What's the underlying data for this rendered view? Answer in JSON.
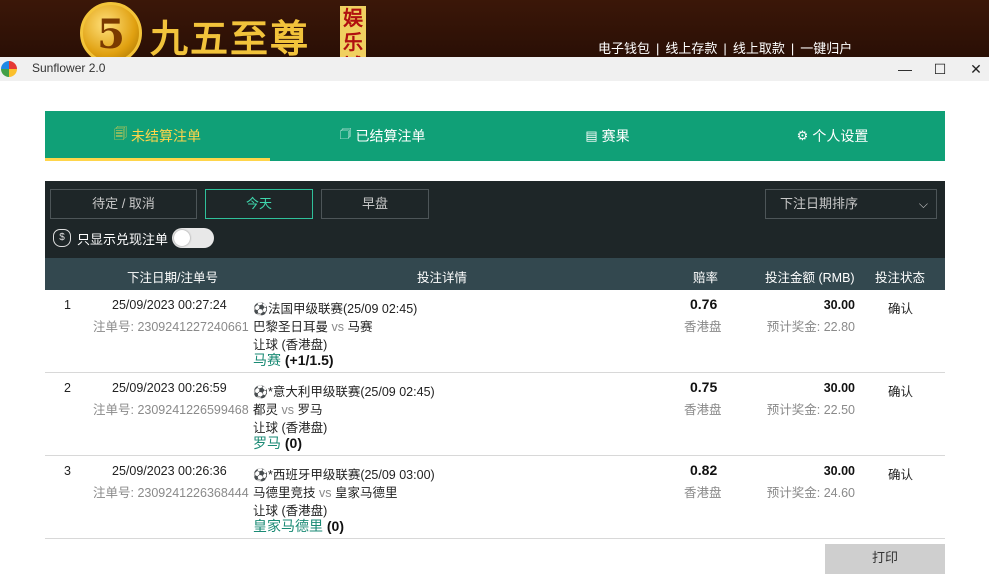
{
  "banner": {
    "logo_numeral": "5",
    "logo_text": "九五至尊",
    "logo_tag": "娱乐城",
    "links": [
      "电子钱包",
      "线上存款",
      "线上取款",
      "一键归户"
    ],
    "separator": "|"
  },
  "window": {
    "title": "Sunflower 2.0",
    "minimize": "—",
    "maximize": "☐",
    "close": "✕"
  },
  "tabs": [
    {
      "label": "未结算注单",
      "icon": "receipt-icon",
      "glyph": "🗐",
      "active": true
    },
    {
      "label": "已结算注单",
      "icon": "settled-icon",
      "glyph": "🗇",
      "active": false
    },
    {
      "label": "赛果",
      "icon": "results-icon",
      "glyph": "▤",
      "active": false
    },
    {
      "label": "个人设置",
      "icon": "gear-icon",
      "glyph": "⚙",
      "active": false
    }
  ],
  "filters": {
    "pending_cancel": "待定 / 取消",
    "today": "今天",
    "early": "早盘",
    "sort_selected": "下注日期排序",
    "cashout_toggle_label": "只显示兑现注单",
    "cashout_icon_glyph": "$",
    "chevron": "⌵"
  },
  "table": {
    "headers": {
      "date_id": "下注日期/注单号",
      "details": "投注详情",
      "odds": "赔率",
      "amount": "投注金额 (RMB)",
      "status": "投注状态"
    },
    "rows": [
      {
        "index": "1",
        "datetime": "25/09/2023 00:27:24",
        "bet_id_label": "注单号: 2309241227240661",
        "league": "法国甲级联赛(25/09 02:45)",
        "home": "巴黎圣日耳曼",
        "vs": "vs",
        "away": "马赛",
        "market": "让球 (香港盘)",
        "pick_team": "马赛",
        "pick_line": "(+1/1.5)",
        "odds": "0.76",
        "odds_type": "香港盘",
        "stake": "30.00",
        "payout": "预计奖金: 22.80",
        "status": "确认"
      },
      {
        "index": "2",
        "datetime": "25/09/2023 00:26:59",
        "bet_id_label": "注单号: 2309241226599468",
        "league": "*意大利甲级联赛(25/09 02:45)",
        "home": "都灵",
        "vs": "vs",
        "away": "罗马",
        "market": "让球 (香港盘)",
        "pick_team": "罗马",
        "pick_line": "(0)",
        "odds": "0.75",
        "odds_type": "香港盘",
        "stake": "30.00",
        "payout": "预计奖金: 22.50",
        "status": "确认"
      },
      {
        "index": "3",
        "datetime": "25/09/2023 00:26:36",
        "bet_id_label": "注单号: 2309241226368444",
        "league": "*西班牙甲级联赛(25/09 03:00)",
        "home": "马德里竞技",
        "vs": "vs",
        "away": "皇家马德里",
        "market": "让球 (香港盘)",
        "pick_team": "皇家马德里",
        "pick_line": "(0)",
        "odds": "0.82",
        "odds_type": "香港盘",
        "stake": "30.00",
        "payout": "预计奖金: 24.60",
        "status": "确认"
      }
    ]
  },
  "print_label": "打印",
  "colors": {
    "tab_green": "#10a077",
    "active_gold": "#ffd54a",
    "panel_dark": "#1e2628",
    "header_slate": "#33484f",
    "team_teal": "#1a8a74"
  }
}
